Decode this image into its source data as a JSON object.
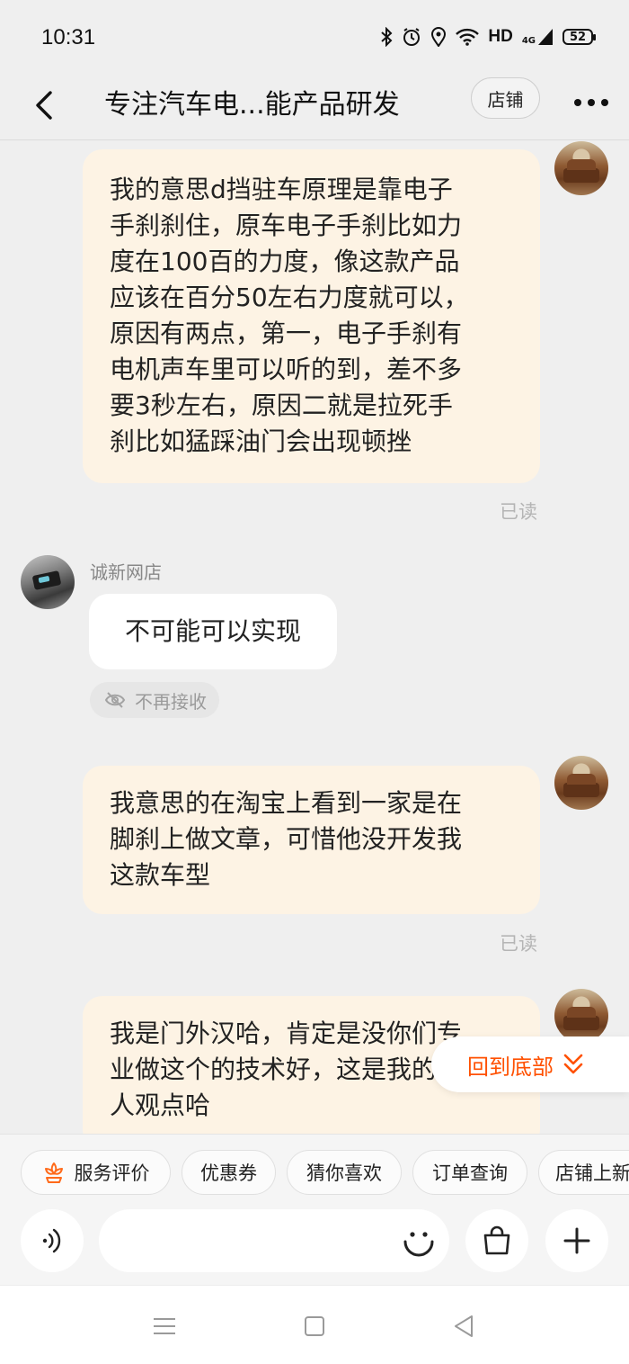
{
  "status_bar": {
    "time": "10:31",
    "hd": "HD",
    "network": "4G",
    "battery": "52"
  },
  "header": {
    "title": "专注汽车电...能产品研发",
    "shop_button": "店铺"
  },
  "messages": [
    {
      "side": "right",
      "lines": [
        "我的意思d挡驻车原理是靠电子",
        "手刹刹住，原车电子手刹比如力",
        "度在100百的力度，像这款产品",
        "应该在百分50左右力度就可以，",
        "原因有两点，第一，电子手刹有",
        "电机声车里可以听的到，差不多",
        "要3秒左右，原因二就是拉死手",
        "刹比如猛踩油门会出现顿挫"
      ],
      "status": "已读"
    },
    {
      "side": "left",
      "sender": "诚新网店",
      "text": "不可能可以实现",
      "mute_label": "不再接收"
    },
    {
      "side": "right",
      "lines": [
        "我意思的在淘宝上看到一家是在",
        "脚刹上做文章，可惜他没开发我",
        "这款车型"
      ],
      "status": "已读"
    },
    {
      "side": "right",
      "lines": [
        "我是门外汉哈，肯定是没你们专",
        "业做这个的技术好，这是我的个",
        "人观点哈"
      ]
    }
  ],
  "scroll_to_bottom": "回到底部",
  "quick_actions": [
    "服务评价",
    "优惠券",
    "猜你喜欢",
    "订单查询",
    "店铺上新"
  ],
  "input": {
    "value": "",
    "placeholder": ""
  },
  "colors": {
    "accent": "#ff5000",
    "bubble_self": "#fdf3e4",
    "bubble_other": "#ffffff",
    "background": "#efefef"
  },
  "icons": {
    "back": "back-arrow-icon",
    "more": "more-dots-icon",
    "voice": "voice-icon",
    "emoji": "smile-icon",
    "bag": "shopping-bag-icon",
    "plus": "plus-icon",
    "mute": "mute-eye-icon",
    "flower": "flower-icon",
    "chevron": "double-chevron-down-icon"
  }
}
